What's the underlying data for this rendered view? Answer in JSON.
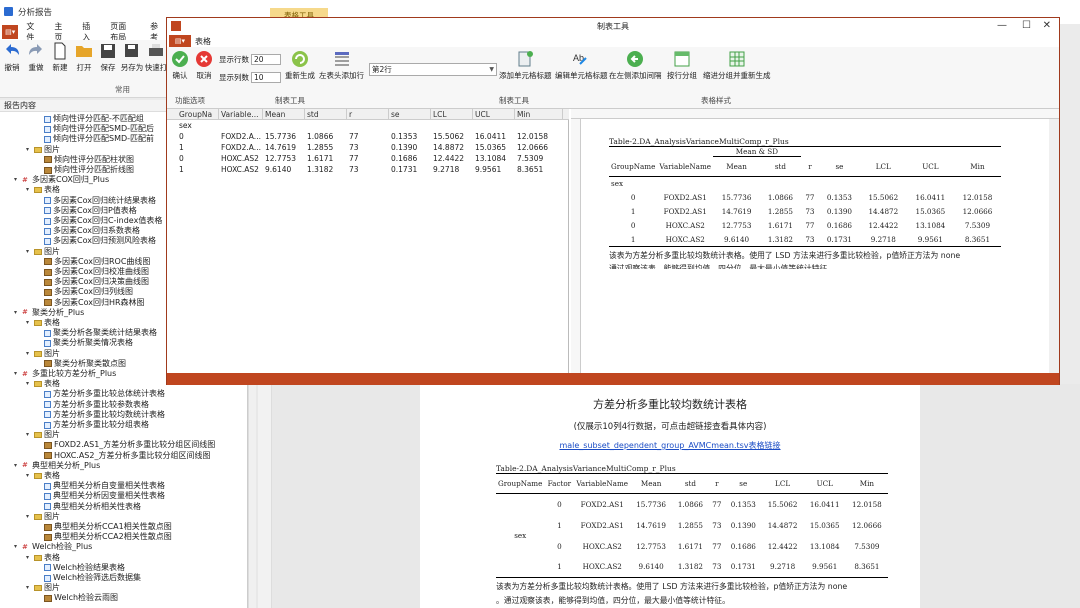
{
  "app": {
    "title": "分析报告",
    "tab_hint": "表格工具",
    "menu": [
      "文件",
      "主页",
      "插入",
      "页面布局",
      "参考"
    ],
    "ribbon": [
      {
        "label": "撤销",
        "icon": "undo-icon"
      },
      {
        "label": "重做",
        "icon": "redo-icon"
      },
      {
        "label": "新建",
        "icon": "new-file-icon"
      },
      {
        "label": "打开",
        "icon": "open-folder-icon"
      },
      {
        "label": "保存",
        "icon": "save-icon"
      },
      {
        "label": "另存为",
        "icon": "save-as-icon"
      },
      {
        "label": "快速打",
        "icon": "print-icon"
      }
    ],
    "ribbon_group": "常用",
    "report_label": "报告内容"
  },
  "tree": [
    {
      "label": "倾向性评分匹配-不匹配组",
      "kind": "table",
      "level": 3
    },
    {
      "label": "倾向性评分匹配SMD-匹配后",
      "kind": "table",
      "level": 3
    },
    {
      "label": "倾向性评分匹配SMD-匹配前",
      "kind": "table",
      "level": 3
    },
    {
      "label": "图片",
      "kind": "folder",
      "level": 2
    },
    {
      "label": "倾向性评分匹配柱状图",
      "kind": "pic",
      "level": 3
    },
    {
      "label": "倾向性评分匹配折线图",
      "kind": "pic",
      "level": 3
    },
    {
      "label": "多因素COX回归_Plus",
      "kind": "node",
      "level": 1
    },
    {
      "label": "表格",
      "kind": "folder",
      "level": 2
    },
    {
      "label": "多因素Cox回归统计结果表格",
      "kind": "table",
      "level": 3
    },
    {
      "label": "多因素Cox回归P值表格",
      "kind": "table",
      "level": 3
    },
    {
      "label": "多因素Cox回归C-index值表格",
      "kind": "table",
      "level": 3
    },
    {
      "label": "多因素Cox回归系数表格",
      "kind": "table",
      "level": 3
    },
    {
      "label": "多因素Cox回归预测风险表格",
      "kind": "table",
      "level": 3
    },
    {
      "label": "图片",
      "kind": "folder",
      "level": 2
    },
    {
      "label": "多因素Cox回归ROC曲线图",
      "kind": "pic",
      "level": 3
    },
    {
      "label": "多因素Cox回归校准曲线图",
      "kind": "pic",
      "level": 3
    },
    {
      "label": "多因素Cox回归决策曲线图",
      "kind": "pic",
      "level": 3
    },
    {
      "label": "多因素Cox回归列线图",
      "kind": "pic",
      "level": 3
    },
    {
      "label": "多因素Cox回归HR森林图",
      "kind": "pic",
      "level": 3
    },
    {
      "label": "聚类分析_Plus",
      "kind": "node",
      "level": 1
    },
    {
      "label": "表格",
      "kind": "folder",
      "level": 2
    },
    {
      "label": "聚类分析各聚类统计结果表格",
      "kind": "table",
      "level": 3
    },
    {
      "label": "聚类分析聚类情况表格",
      "kind": "table",
      "level": 3
    },
    {
      "label": "图片",
      "kind": "folder",
      "level": 2
    },
    {
      "label": "聚类分析聚类散点图",
      "kind": "pic",
      "level": 3
    },
    {
      "label": "多重比较方差分析_Plus",
      "kind": "node",
      "level": 1
    },
    {
      "label": "表格",
      "kind": "folder",
      "level": 2
    },
    {
      "label": "方差分析多重比较总体统计表格",
      "kind": "table",
      "level": 3
    },
    {
      "label": "方差分析多重比较参数表格",
      "kind": "table",
      "level": 3
    },
    {
      "label": "方差分析多重比较均数统计表格",
      "kind": "table",
      "level": 3
    },
    {
      "label": "方差分析多重比较分组表格",
      "kind": "table",
      "level": 3
    },
    {
      "label": "图片",
      "kind": "folder",
      "level": 2
    },
    {
      "label": "FOXD2.AS1_方差分析多重比较分组区间线图",
      "kind": "pic",
      "level": 3
    },
    {
      "label": "HOXC.AS2_方差分析多重比较分组区间线图",
      "kind": "pic",
      "level": 3
    },
    {
      "label": "典型相关分析_Plus",
      "kind": "node",
      "level": 1
    },
    {
      "label": "表格",
      "kind": "folder",
      "level": 2
    },
    {
      "label": "典型相关分析自变量相关性表格",
      "kind": "table",
      "level": 3
    },
    {
      "label": "典型相关分析因变量相关性表格",
      "kind": "table",
      "level": 3
    },
    {
      "label": "典型相关分析相关性表格",
      "kind": "table",
      "level": 3
    },
    {
      "label": "图片",
      "kind": "folder",
      "level": 2
    },
    {
      "label": "典型相关分析CCA1相关性散点图",
      "kind": "pic",
      "level": 3
    },
    {
      "label": "典型相关分析CCA2相关性散点图",
      "kind": "pic",
      "level": 3
    },
    {
      "label": "Welch检验_Plus",
      "kind": "node",
      "level": 1
    },
    {
      "label": "表格",
      "kind": "folder",
      "level": 2
    },
    {
      "label": "Welch检验结果表格",
      "kind": "table",
      "level": 3
    },
    {
      "label": "Welch检验筛选后数据集",
      "kind": "table",
      "level": 3
    },
    {
      "label": "图片",
      "kind": "folder",
      "level": 2
    },
    {
      "label": "Welch检验云雨图",
      "kind": "pic",
      "level": 3
    }
  ],
  "dialog": {
    "title": "制表工具",
    "tab": "表格",
    "confirm": "确认",
    "cancel": "取消",
    "rows_label": "显示行数",
    "rows_value": "20",
    "cols_label": "显示列数",
    "cols_value": "10",
    "regen": "重新生成",
    "add_header_col": "左表头添加行",
    "row_select": "第2行",
    "add_cell_title": "添加单元格标题",
    "edit_cell_title": "编辑单元格标题",
    "insert_left_col": "在左侧添加间隔",
    "split_group": "按行分组",
    "merge_group": "缩进分组并重新生成",
    "group_func": "功能选项",
    "group_table": "制表工具",
    "group_table2": "制表工具",
    "group_style": "表格样式"
  },
  "grid": {
    "headers": [
      "GroupNa",
      "Variable...",
      "Mean",
      "std",
      "r",
      "se",
      "LCL",
      "UCL",
      "Min"
    ],
    "rows": [
      [
        "sex",
        "",
        "",
        "",
        "",
        "",
        "",
        "",
        ""
      ],
      [
        "0",
        "FOXD2.A...",
        "15.7736",
        "1.0866",
        "77",
        "0.1353",
        "15.5062",
        "16.0411",
        "12.0158"
      ],
      [
        "1",
        "FOXD2.A...",
        "14.7619",
        "1.2855",
        "73",
        "0.1390",
        "14.8872",
        "15.0365",
        "12.0666"
      ],
      [
        "0",
        "HOXC.AS2",
        "12.7753",
        "1.6171",
        "77",
        "0.1686",
        "12.4422",
        "13.1084",
        "7.5309"
      ],
      [
        "1",
        "HOXC.AS2",
        "9.6140",
        "1.3182",
        "73",
        "0.1731",
        "9.2718",
        "9.9561",
        "8.3651"
      ]
    ]
  },
  "preview": {
    "caption": "Table-2.DA_AnalysisVarianceMultiComp_r_Plus",
    "span_head": "Mean & SD",
    "headers": [
      "GroupName",
      "VariableName",
      "Mean",
      "std",
      "r",
      "se",
      "LCL",
      "UCL",
      "Min"
    ],
    "group": "sex",
    "rows": [
      [
        "0",
        "FOXD2.AS1",
        "15.7736",
        "1.0866",
        "77",
        "0.1353",
        "15.5062",
        "16.0411",
        "12.0158"
      ],
      [
        "1",
        "FOXD2.AS1",
        "14.7619",
        "1.2855",
        "73",
        "0.1390",
        "14.4872",
        "15.0365",
        "12.0666"
      ],
      [
        "0",
        "HOXC.AS2",
        "12.7753",
        "1.6171",
        "77",
        "0.1686",
        "12.4422",
        "13.1084",
        "7.5309"
      ],
      [
        "1",
        "HOXC.AS2",
        "9.6140",
        "1.3182",
        "73",
        "0.1731",
        "9.2718",
        "9.9561",
        "8.3651"
      ]
    ],
    "note": "该表为方差分析多重比较均数统计表格。使用了 LSD 方法来进行多重比较检验，p值矫正方法为 none",
    "note2": "通过观察该表，能够得到均值，四分位，最大最小值等统计特征"
  },
  "doc": {
    "title": "方差分析多重比较均数统计表格",
    "subtitle": "(仅展示10列4行数据，可点击超链接查看具体内容)",
    "link": "male_subset_dependent_group_AVMCmean.tsv表格链接",
    "caption": "Table-2.DA_AnalysisVarianceMultiComp_r_Plus",
    "headers": [
      "GroupName",
      "Factor",
      "VariableName",
      "Mean",
      "std",
      "r",
      "se",
      "LCL",
      "UCL",
      "Min"
    ],
    "group": "sex",
    "rows": [
      [
        "0",
        "FOXD2.AS1",
        "15.7736",
        "1.0866",
        "77",
        "0.1353",
        "15.5062",
        "16.0411",
        "12.0158"
      ],
      [
        "1",
        "FOXD2.AS1",
        "14.7619",
        "1.2855",
        "73",
        "0.1390",
        "14.4872",
        "15.0365",
        "12.0666"
      ],
      [
        "0",
        "HOXC.AS2",
        "12.7753",
        "1.6171",
        "77",
        "0.1686",
        "12.4422",
        "13.1084",
        "7.5309"
      ],
      [
        "1",
        "HOXC.AS2",
        "9.6140",
        "1.3182",
        "73",
        "0.1731",
        "9.2718",
        "9.9561",
        "8.3651"
      ]
    ],
    "note": "该表为方差分析多重比较均数统计表格。使用了 LSD 方法来进行多重比较检验，p值矫正方法为 none",
    "note2": "。通过观察该表，能够得到均值，四分位，最大最小值等统计特征。"
  },
  "colors": {
    "accent": "#c0461f",
    "link": "#1a4cc5"
  }
}
